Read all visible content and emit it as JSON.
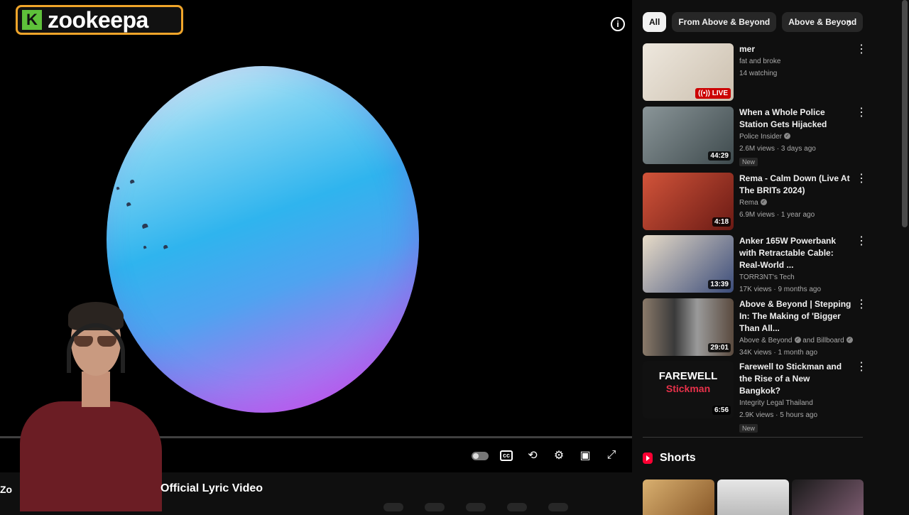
{
  "overlay": {
    "logo_letter": "K",
    "logo_text": "zookeepa"
  },
  "player": {
    "info_icon": "info-icon",
    "video_title": "Official Lyric Video",
    "video_title_prefix": "Zo",
    "controls": {
      "autoplay": "autoplay-toggle",
      "captions": "captions-icon",
      "loop": "loop-icon",
      "settings": "gear-icon",
      "miniplayer": "miniplayer-icon",
      "fullscreen": "fullscreen-icon"
    }
  },
  "chips": [
    {
      "label": "All",
      "active": true
    },
    {
      "label": "From Above & Beyond",
      "active": false
    },
    {
      "label": "Above & Beyond",
      "active": false
    }
  ],
  "videos": [
    {
      "title": "mer",
      "channel": "fat and broke",
      "verified": false,
      "views": "14 watching",
      "badge": "LIVE",
      "new": false,
      "thumb_color": "#d8d0c6"
    },
    {
      "title": "When a Whole Police Station Gets Hijacked",
      "channel": "Police Insider",
      "verified": true,
      "views": "2.6M views · 3 days ago",
      "duration": "44:29",
      "new": true,
      "new_label": "New",
      "thumb_color": "#5d6a6e"
    },
    {
      "title": "Rema - Calm Down (Live At The BRITs 2024)",
      "channel": "Rema",
      "verified": true,
      "views": "6.9M views · 1 year ago",
      "duration": "4:18",
      "new": false,
      "thumb_color": "#b33a2a"
    },
    {
      "title": "Anker 165W Powerbank with Retractable Cable: Real-World ...",
      "channel": "TORR3NT's Tech",
      "verified": false,
      "views": "17K views · 9 months ago",
      "duration": "13:39",
      "new": false,
      "thumb_color": "#3b4c7a"
    },
    {
      "title": "Above & Beyond | Stepping In: The Making of 'Bigger Than All...",
      "channel": "Above & Beyond",
      "channel2": "and Billboard",
      "verified": true,
      "views": "34K views · 1 month ago",
      "duration": "29:01",
      "new": false,
      "thumb_color": "#4a4a4a"
    },
    {
      "title": "Farewell to Stickman and the Rise of a New Bangkok?",
      "channel": "Integrity Legal Thailand",
      "verified": false,
      "views": "2.9K views · 5 hours ago",
      "duration": "6:56",
      "new": true,
      "new_label": "New",
      "thumb_color": "#111111",
      "thumb_text1": "FAREWELL",
      "thumb_text2": "Stickman"
    }
  ],
  "shorts": {
    "label": "Shorts",
    "thumbs": [
      "#c79a55",
      "#d9d9d9",
      "#7a5a6e"
    ]
  },
  "colors": {
    "background": "#0f0f0f",
    "accent": "#ff0033",
    "live": "#cc0000"
  }
}
